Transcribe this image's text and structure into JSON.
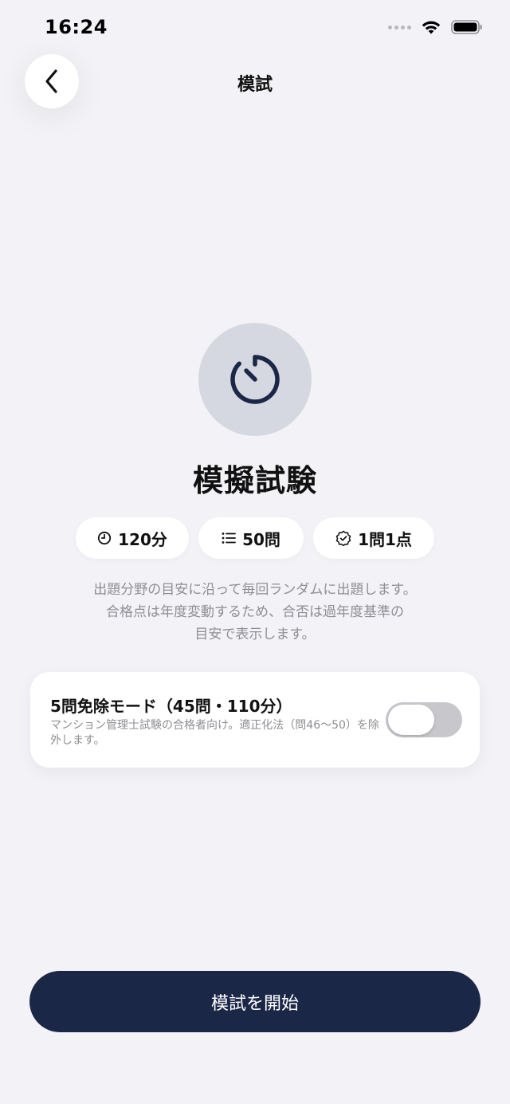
{
  "status_bar": {
    "time": "16:24"
  },
  "nav": {
    "title": "模試"
  },
  "hero": {
    "icon": "timer-icon",
    "title": "模擬試験"
  },
  "chips": [
    {
      "icon": "clock-icon",
      "label": "120分"
    },
    {
      "icon": "list-icon",
      "label": "50問"
    },
    {
      "icon": "check-badge-icon",
      "label": "1問1点"
    }
  ],
  "description": {
    "line1": "出題分野の目安に沿って毎回ランダムに出題します。",
    "line2": "合格点は年度変動するため、合否は過年度基準の",
    "line3": "目安で表示します。"
  },
  "option": {
    "title": "5問免除モード（45問・110分）",
    "description": "マンション管理士試験の合格者向け。適正化法（問46〜50）を除外します。",
    "enabled": false
  },
  "start_button": {
    "label": "模試を開始"
  },
  "colors": {
    "background": "#f2f2f7",
    "primary": "#1b2747",
    "icon_circle": "#d5d8e0",
    "toggle_off": "#c7c7cc",
    "secondary_text": "#8e8e93"
  }
}
